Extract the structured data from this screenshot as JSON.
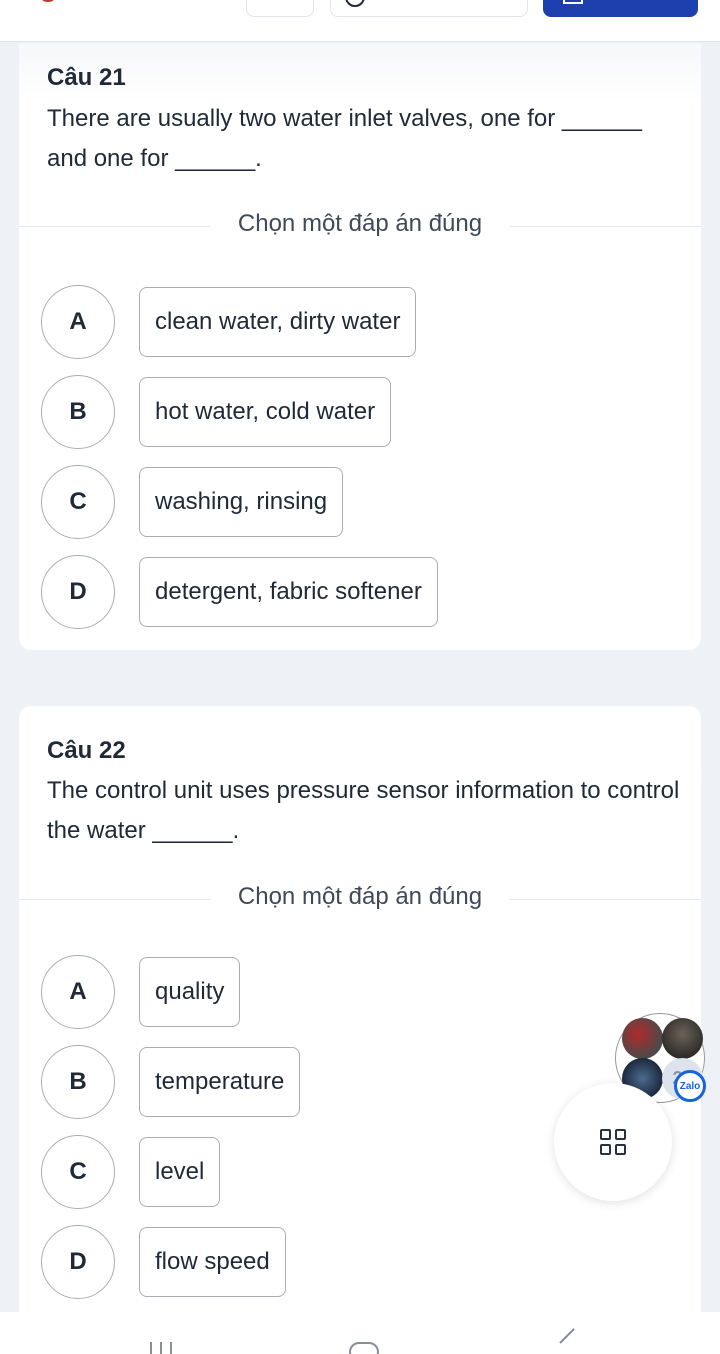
{
  "header": {
    "icons": [
      "timer-icon",
      "list-icon",
      "search-icon",
      "submit-icon"
    ]
  },
  "questions": [
    {
      "title": "Câu 21",
      "text": "There are usually two water inlet valves, one for ______ and one for ______.",
      "prompt": "Chọn một đáp án đúng",
      "options": [
        {
          "letter": "A",
          "text": "clean water, dirty water"
        },
        {
          "letter": "B",
          "text": "hot water, cold water"
        },
        {
          "letter": "C",
          "text": "washing, rinsing"
        },
        {
          "letter": "D",
          "text": "detergent, fabric softener"
        }
      ]
    },
    {
      "title": "Câu 22",
      "text": "The control unit uses pressure sensor information to control the water ______.",
      "prompt": "Chọn một đáp án đúng",
      "options": [
        {
          "letter": "A",
          "text": "quality"
        },
        {
          "letter": "B",
          "text": "temperature"
        },
        {
          "letter": "C",
          "text": "level"
        },
        {
          "letter": "D",
          "text": "flow speed"
        }
      ]
    }
  ],
  "zalo_widget": {
    "count_label": "20",
    "badge_label": "Zalo"
  },
  "colors": {
    "accent": "#1e40af",
    "background": "#eef1f5",
    "card": "#ffffff",
    "text": "#1f2937",
    "option_border": "#a9aeb5"
  }
}
